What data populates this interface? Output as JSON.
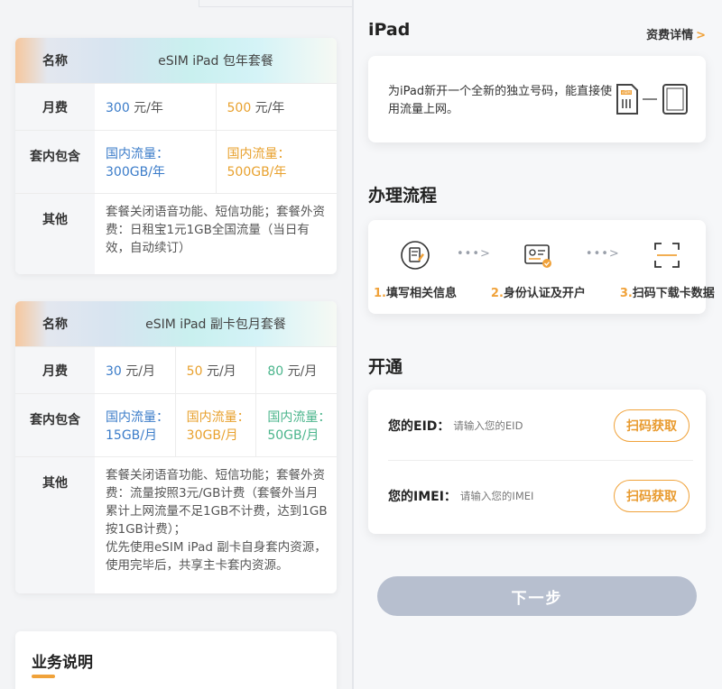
{
  "plan_annual": {
    "head_label": "名称",
    "title": "eSIM iPad 包年套餐",
    "monthly_fee_label": "月费",
    "fees": [
      {
        "value": "300",
        "unit": " 元/年"
      },
      {
        "value": "500",
        "unit": " 元/年"
      }
    ],
    "included_label": "套内包含",
    "included": [
      {
        "line1": "国内流量：",
        "line2": "300GB/年"
      },
      {
        "line1": "国内流量：",
        "line2": "500GB/年"
      }
    ],
    "other_label": "其他",
    "other_text": "套餐关闭语音功能、短信功能；套餐外资费：日租宝1元1GB全国流量（当日有效，自动续订）"
  },
  "plan_monthly": {
    "head_label": "名称",
    "title": "eSIM iPad 副卡包月套餐",
    "monthly_fee_label": "月费",
    "fees": [
      {
        "value": "30",
        "unit": " 元/月"
      },
      {
        "value": "50",
        "unit": " 元/月"
      },
      {
        "value": "80",
        "unit": " 元/月"
      }
    ],
    "included_label": "套内包含",
    "included": [
      {
        "line1": "国内流量：",
        "line2": "15GB/月"
      },
      {
        "line1": "国内流量：",
        "line2": "30GB/月"
      },
      {
        "line1": "国内流量：",
        "line2": "50GB/月"
      }
    ],
    "other_label": "其他",
    "other_text": "套餐关闭语音功能、短信功能；套餐外资费：流量按照3元/GB计费（套餐外当月累计上网流量不足1GB不计费，达到1GB按1GB计费）；\n优先使用eSIM iPad 副卡自身套内资源，使用完毕后，共享主卡套内资源。"
  },
  "business": {
    "title": "业务说明"
  },
  "ipad": {
    "title": "iPad",
    "fee_link": "资费详情",
    "fee_arrow": ">",
    "description": "为iPad新开一个全新的独立号码，能直接使用流量上网。",
    "sim_text": "eSIM"
  },
  "process": {
    "title": "办理流程",
    "steps": [
      {
        "num": "1.",
        "label": "填写相关信息",
        "icon": "form-edit-icon"
      },
      {
        "num": "2.",
        "label": "身份认证及开户",
        "icon": "id-card-verify-icon"
      },
      {
        "num": "3.",
        "label": "扫码下载卡数据",
        "icon": "scan-download-icon"
      }
    ],
    "connector": "•••>"
  },
  "activate": {
    "title": "开通",
    "eid_label": "您的EID：",
    "eid_placeholder": "请输入您的EID",
    "imei_label": "您的IMEI：",
    "imei_placeholder": "请输入您的IMEI",
    "scan_label": "扫码获取"
  },
  "next_button": "下一步",
  "colors": {
    "accent": "#f0a23a",
    "blue": "#3b7cc9",
    "green": "#4bb58c",
    "button_disabled": "#b7bfcf"
  }
}
